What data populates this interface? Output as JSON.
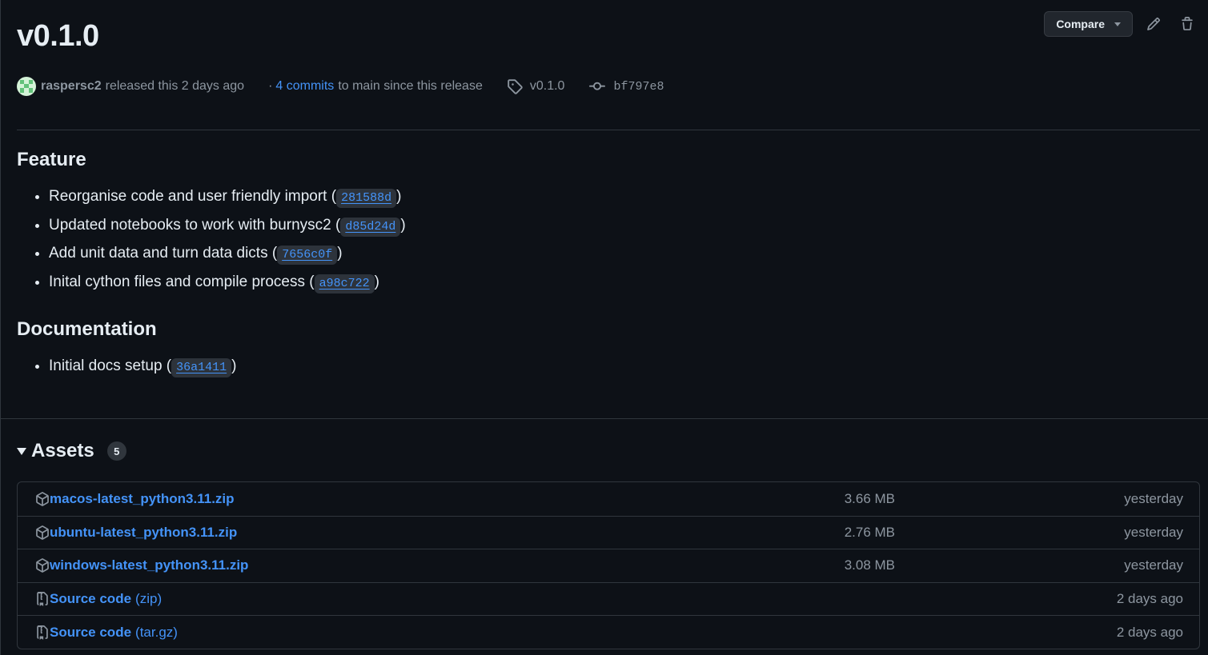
{
  "release": {
    "title": "v0.1.0",
    "author": "raspersc2",
    "released_text": "released this 2 days ago",
    "dot": "·",
    "commits_link": "4 commits",
    "commits_suffix": "to main since this release",
    "tag": "v0.1.0",
    "commit_sha": "bf797e8"
  },
  "actions": {
    "compare_label": "Compare",
    "edit_icon": "pencil-icon",
    "delete_icon": "trash-icon"
  },
  "notes": {
    "feature_heading": "Feature",
    "features": [
      {
        "text": "Reorganise code and user friendly import (",
        "sha": "281588d",
        "close": ")"
      },
      {
        "text": "Updated notebooks to work with burnysc2 (",
        "sha": "d85d24d",
        "close": ")"
      },
      {
        "text": "Add unit data and turn data dicts (",
        "sha": "7656c0f",
        "close": ")"
      },
      {
        "text": "Inital cython files and compile process (",
        "sha": "a98c722",
        "close": ")"
      }
    ],
    "docs_heading": "Documentation",
    "docs": [
      {
        "text": "Initial docs setup (",
        "sha": "36a1411",
        "close": ")"
      }
    ]
  },
  "assets": {
    "title": "Assets",
    "count": "5",
    "items": [
      {
        "icon": "package-icon",
        "name": "macos-latest_python3.11.zip",
        "suffix": "",
        "size": "3.66 MB",
        "date": "yesterday"
      },
      {
        "icon": "package-icon",
        "name": "ubuntu-latest_python3.11.zip",
        "suffix": "",
        "size": "2.76 MB",
        "date": "yesterday"
      },
      {
        "icon": "package-icon",
        "name": "windows-latest_python3.11.zip",
        "suffix": "",
        "size": "3.08 MB",
        "date": "yesterday"
      },
      {
        "icon": "file-zip-icon",
        "name": "Source code",
        "suffix": "(zip)",
        "size": "",
        "date": "2 days ago"
      },
      {
        "icon": "file-zip-icon",
        "name": "Source code",
        "suffix": "(tar.gz)",
        "size": "",
        "date": "2 days ago"
      }
    ]
  },
  "colors": {
    "background": "#0d1117",
    "link": "#4493f8",
    "muted": "#8d96a0",
    "border": "#30363d"
  }
}
